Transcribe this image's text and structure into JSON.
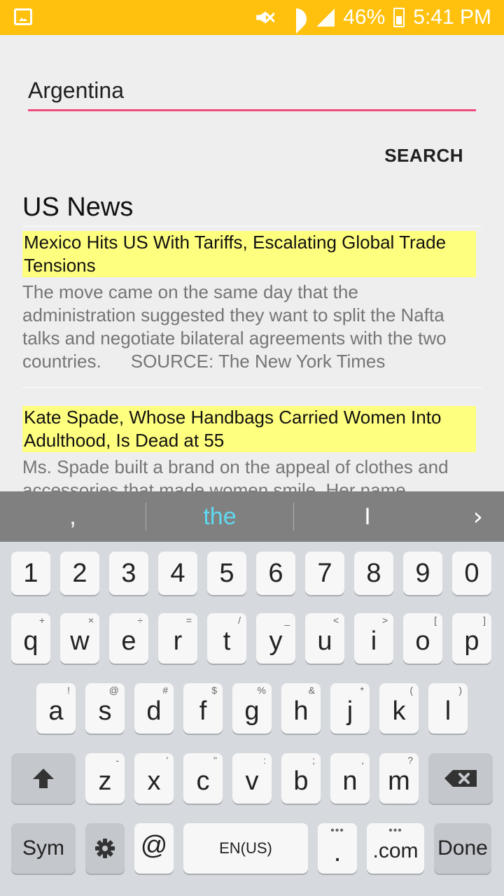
{
  "status_bar": {
    "battery": "46%",
    "time": "5:41 PM",
    "left_icon": "image-icon",
    "icons": [
      "mute-vibrate-icon",
      "wifi-icon",
      "signal-icon",
      "battery-charging-icon"
    ],
    "background": "#ffc10d"
  },
  "search": {
    "value": "Argentina",
    "button_label": "SEARCH",
    "underline_color": "#ee4b7d"
  },
  "section": {
    "title": "US News"
  },
  "news": [
    {
      "headline": "Mexico Hits US With Tariffs, Escalating Global Trade Tensions",
      "summary": "The move came on the same day that the administration suggested they want to split the Nafta talks and negotiate bilateral agreements with the two countries.",
      "source": "SOURCE: The New York Times"
    },
    {
      "headline": "Kate Spade, Whose Handbags Carried Women Into Adulthood, Is Dead at 55",
      "summary": "Ms. Spade built a brand on the appeal of clothes and accessories that made women smile. Her name"
    }
  ],
  "highlight_color": "#ffff7f",
  "keyboard": {
    "suggestions": [
      ",",
      "the",
      "I"
    ],
    "suggestion_highlight_color": "#5fd8f0",
    "numbers": [
      "1",
      "2",
      "3",
      "4",
      "5",
      "6",
      "7",
      "8",
      "9",
      "0"
    ],
    "row1": [
      {
        "k": "q",
        "s": "+"
      },
      {
        "k": "w",
        "s": "×"
      },
      {
        "k": "e",
        "s": "÷"
      },
      {
        "k": "r",
        "s": "="
      },
      {
        "k": "t",
        "s": "/"
      },
      {
        "k": "y",
        "s": "_"
      },
      {
        "k": "u",
        "s": "<"
      },
      {
        "k": "i",
        "s": ">"
      },
      {
        "k": "o",
        "s": "["
      },
      {
        "k": "p",
        "s": "]"
      }
    ],
    "row2": [
      {
        "k": "a",
        "s": "!"
      },
      {
        "k": "s",
        "s": "@"
      },
      {
        "k": "d",
        "s": "#"
      },
      {
        "k": "f",
        "s": "$"
      },
      {
        "k": "g",
        "s": "%"
      },
      {
        "k": "h",
        "s": "&"
      },
      {
        "k": "j",
        "s": "*"
      },
      {
        "k": "k",
        "s": "("
      },
      {
        "k": "l",
        "s": ")"
      }
    ],
    "row3": [
      {
        "k": "z",
        "s": "-"
      },
      {
        "k": "x",
        "s": "'"
      },
      {
        "k": "c",
        "s": "\""
      },
      {
        "k": "v",
        "s": ":"
      },
      {
        "k": "b",
        "s": ";"
      },
      {
        "k": "n",
        "s": ","
      },
      {
        "k": "m",
        "s": "?"
      }
    ],
    "sym_label": "Sym",
    "at_label": "@",
    "space_label": "EN(US)",
    "period_label": ".",
    "dotcom_label": ".com",
    "done_label": "Done"
  }
}
